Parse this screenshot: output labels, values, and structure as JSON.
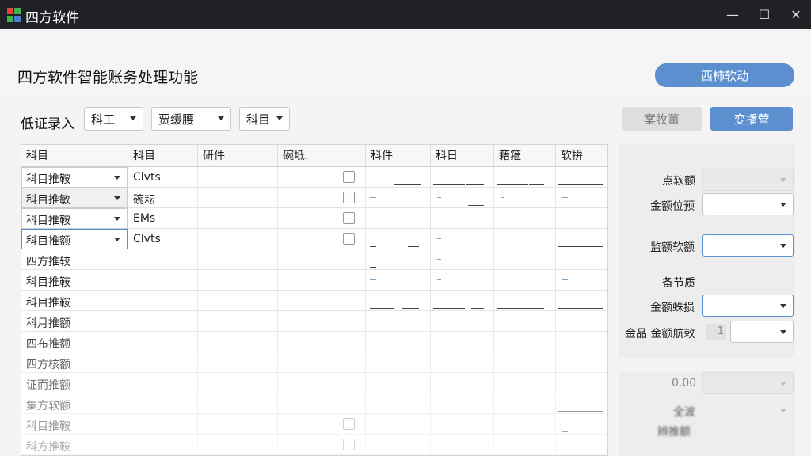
{
  "window": {
    "title": "四方软件",
    "minimize": "—",
    "maximize": "☐",
    "close": "✕"
  },
  "header": {
    "title": "四方软件智能账务处理功能",
    "top_button": "西柿软动"
  },
  "toolbar": {
    "label": "低证录入",
    "selects": [
      "科工",
      "贾缓腰",
      "科目"
    ],
    "button_gray": "案牧薑",
    "button_blue": "变播营"
  },
  "grid": {
    "columns": [
      "科目",
      "科目",
      "研件",
      "碗坻.",
      "科件",
      "科日",
      "藉箍",
      "软拚"
    ],
    "rows": [
      {
        "c0": "科目推鞍",
        "c1": "Clvts",
        "checkbox": true,
        "sel": "normal"
      },
      {
        "c0": "科目推敏",
        "c1": "碗耘",
        "checkbox": true,
        "sel": "shaded"
      },
      {
        "c0": "科目推鞍",
        "c1": "EMs",
        "checkbox": true,
        "sel": "normal"
      },
      {
        "c0": "科目推额",
        "c1": "Clvts",
        "checkbox": true,
        "sel": "focused"
      },
      {
        "c0": "四方推较",
        "c1": "",
        "checkbox": false,
        "sel": "none"
      },
      {
        "c0": "科目推鞍",
        "c1": "",
        "checkbox": false,
        "sel": "none"
      },
      {
        "c0": "科目推鞍",
        "c1": "",
        "checkbox": false,
        "sel": "none"
      },
      {
        "c0": "科月推额",
        "c1": "",
        "checkbox": false,
        "sel": "none"
      },
      {
        "c0": "四布推额",
        "c1": "",
        "checkbox": false,
        "sel": "none"
      },
      {
        "c0": "四方核额",
        "c1": "",
        "checkbox": false,
        "sel": "none"
      },
      {
        "c0": "证而推额",
        "c1": "",
        "checkbox": false,
        "sel": "none"
      },
      {
        "c0": "集方软额",
        "c1": "",
        "checkbox": false,
        "sel": "none"
      },
      {
        "c0": "科目推鞍",
        "c1": "",
        "checkbox": true,
        "sel": "none"
      },
      {
        "c0": "科方推鞍",
        "c1": "",
        "checkbox": true,
        "sel": "none"
      }
    ]
  },
  "panel": {
    "fields": [
      "点软额",
      "金额位预",
      "监额软额",
      "备节质",
      "金额蛛损",
      "金品 金额航敕"
    ],
    "chip_value": "1",
    "value_label": "0.00",
    "blur_1": "全波",
    "blur_2": "辨推额"
  }
}
